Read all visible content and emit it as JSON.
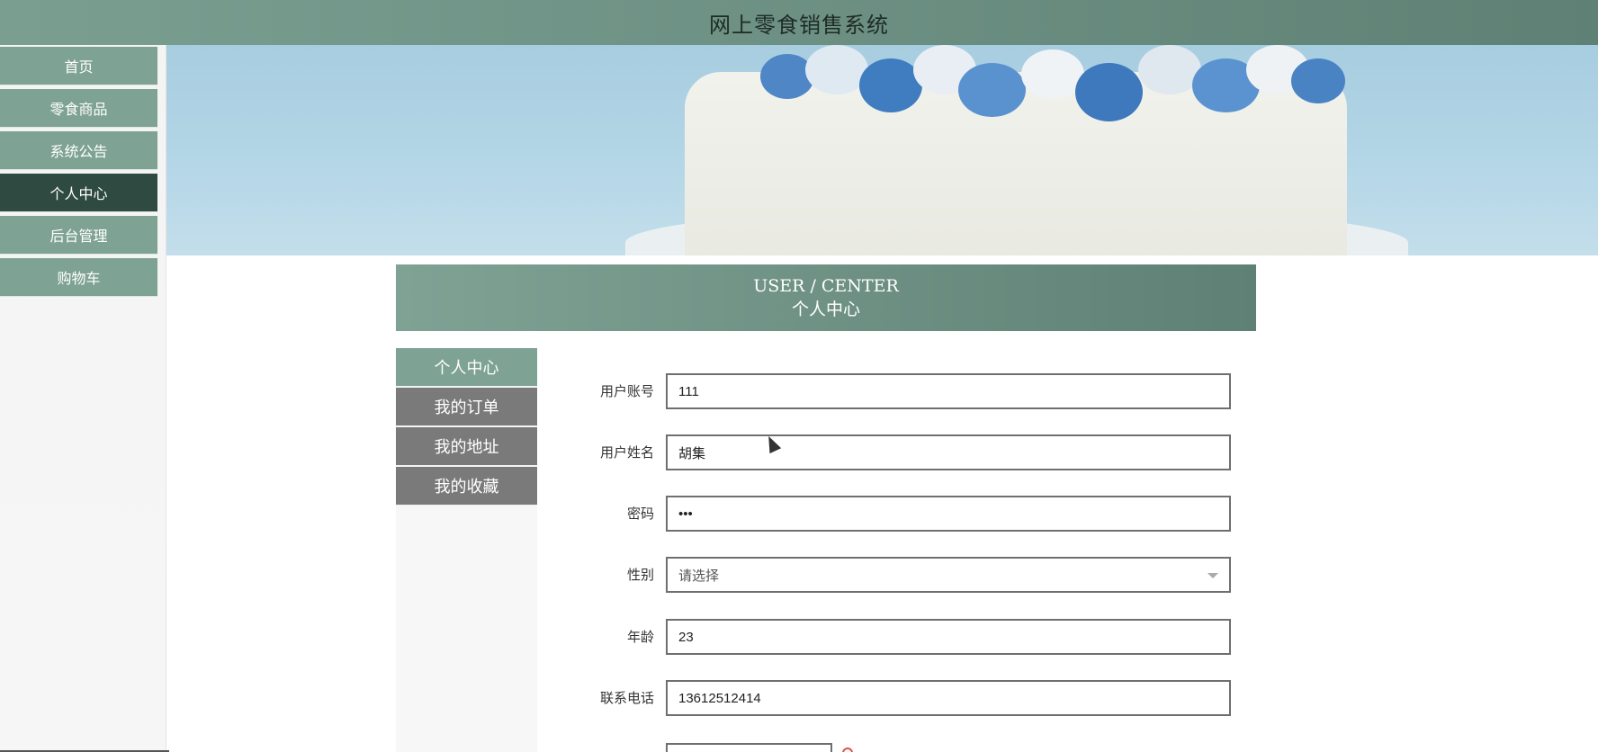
{
  "header": {
    "title": "网上零食销售系统"
  },
  "nav": {
    "items": [
      {
        "label": "首页"
      },
      {
        "label": "零食商品"
      },
      {
        "label": "系统公告"
      },
      {
        "label": "个人中心",
        "active": true
      },
      {
        "label": "后台管理"
      },
      {
        "label": "购物车"
      }
    ]
  },
  "panel": {
    "title_en": "USER / CENTER",
    "title_cn": "个人中心"
  },
  "subnav": {
    "items": [
      {
        "label": "个人中心",
        "active": true
      },
      {
        "label": "我的订单"
      },
      {
        "label": "我的地址"
      },
      {
        "label": "我的收藏"
      }
    ]
  },
  "form": {
    "username": {
      "label": "用户账号",
      "value": "111"
    },
    "name": {
      "label": "用户姓名",
      "value": "胡集"
    },
    "password": {
      "label": "密码",
      "value": "•••"
    },
    "gender": {
      "label": "性别",
      "value": "请选择"
    },
    "age": {
      "label": "年龄",
      "value": "23"
    },
    "phone": {
      "label": "联系电话",
      "value": "13612512414"
    }
  },
  "colors": {
    "accent": "#7ea293",
    "accent_dark": "#2f4a41",
    "subnav_gray": "#7a7a7a"
  }
}
